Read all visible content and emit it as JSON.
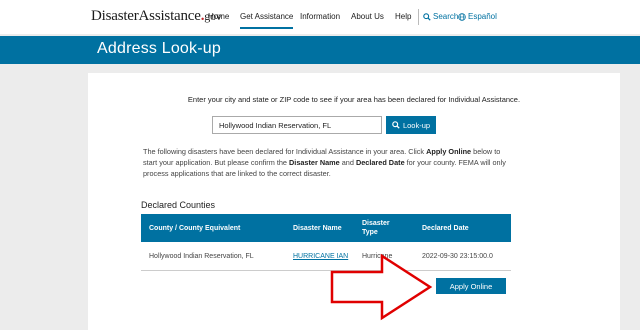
{
  "header": {
    "logo_name": "DisasterAssistance",
    "logo_dot": ".",
    "logo_gov": "gov",
    "nav": [
      {
        "label": "Home"
      },
      {
        "label": "Get Assistance"
      },
      {
        "label": "Information"
      },
      {
        "label": "About Us"
      },
      {
        "label": "Help"
      }
    ],
    "search_label": "Search",
    "language_label": "Español"
  },
  "page": {
    "title": "Address Look-up"
  },
  "lookup": {
    "intro": "Enter your city and state or ZIP code to see if your area has been declared for Individual Assistance.",
    "input_value": "Hollywood Indian Reservation, FL",
    "button_label": "Look-up"
  },
  "notice": {
    "part1": "The following disasters have been declared for Individual Assistance in your area. Click ",
    "apply_bold": "Apply Online",
    "part2": " below to start your application. But please confirm the ",
    "disaster_name_bold": "Disaster Name",
    "part3": " and ",
    "declared_date_bold": "Declared Date",
    "part4": " for your county. FEMA will only process applications that are linked to the correct disaster."
  },
  "declared": {
    "heading": "Declared Counties",
    "columns": {
      "county": "County / County Equivalent",
      "disaster_name": "Disaster Name",
      "disaster_type_1": "Disaster",
      "disaster_type_2": "Type",
      "declared_date": "Declared Date"
    },
    "rows": [
      {
        "county": "Hollywood Indian Reservation, FL",
        "disaster_name": "HURRICANE IAN",
        "disaster_type": "Hurricane",
        "declared_date": "2022-09-30 23:15:00.0"
      }
    ],
    "apply_button": "Apply Online"
  },
  "colors": {
    "brand_blue": "#0071a1",
    "arrow_red": "#e00000"
  },
  "icons": {
    "search": "search-icon",
    "globe": "globe-icon",
    "arrow": "red-arrow-icon"
  }
}
